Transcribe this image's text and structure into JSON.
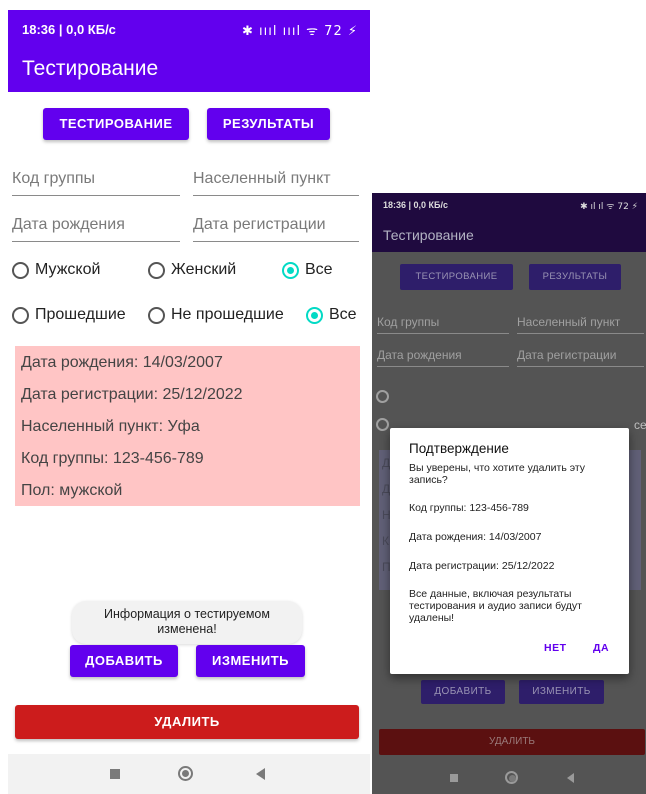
{
  "status_bar": {
    "time": "18:36 | 0,0 КБ/с",
    "icons": "✱ ıııl ıııl ᯤ 72 ⚡"
  },
  "app": {
    "title": "Тестирование"
  },
  "buttons": {
    "testing": "ТЕСТИРОВАНИЕ",
    "results": "РЕЗУЛЬТАТЫ",
    "add": "ДОБАВИТЬ",
    "edit": "ИЗМЕНИТЬ",
    "delete": "УДАЛИТЬ"
  },
  "fields": {
    "group_code": "Код группы",
    "locality": "Населенный пункт",
    "birth_date": "Дата рождения",
    "registration_date": "Дата регистрации"
  },
  "gender_filter": {
    "options": [
      "Мужской",
      "Женский",
      "Все"
    ],
    "selected": "Все"
  },
  "pass_filter": {
    "options": [
      "Прошедшие",
      "Не прошедшие",
      "Все"
    ],
    "selected": "Все"
  },
  "record": {
    "birth_date": "Дата рождения: 14/03/2007",
    "registration_date": "Дата регистрации: 25/12/2022",
    "locality": "Населенный пункт: Уфа",
    "group_code": "Код группы: 123-456-789",
    "gender": "Пол: мужской",
    "background_color": "#ffc5c5"
  },
  "toast": {
    "line1": "Информация о тестируемом",
    "line2": "изменена!"
  },
  "second_screen": {
    "status_time": "18:36 | 0,0 КБ/с",
    "status_icons": "✱ ıl ıl ᯤ 72 ⚡",
    "partial_letters": [
      "Д",
      "Д",
      "Н",
      "К",
      "П"
    ],
    "edge_text": "се"
  },
  "dialog": {
    "title": "Подтверждение",
    "question_line1": "Вы уверены, что хотите удалить эту",
    "question_line2": "запись?",
    "group_code": "Код группы: 123-456-789",
    "birth_date": "Дата рождения: 14/03/2007",
    "registration_date": "Дата регистрации: 25/12/2022",
    "warning_line1": "Все данные, включая результаты",
    "warning_line2": "тестирования и аудио записи будут",
    "warning_line3": "удалены!",
    "no": "НЕТ",
    "yes": "ДА"
  },
  "colors": {
    "primary": "#6200ee",
    "accent": "#03dac5",
    "danger": "#cc1c1c"
  }
}
